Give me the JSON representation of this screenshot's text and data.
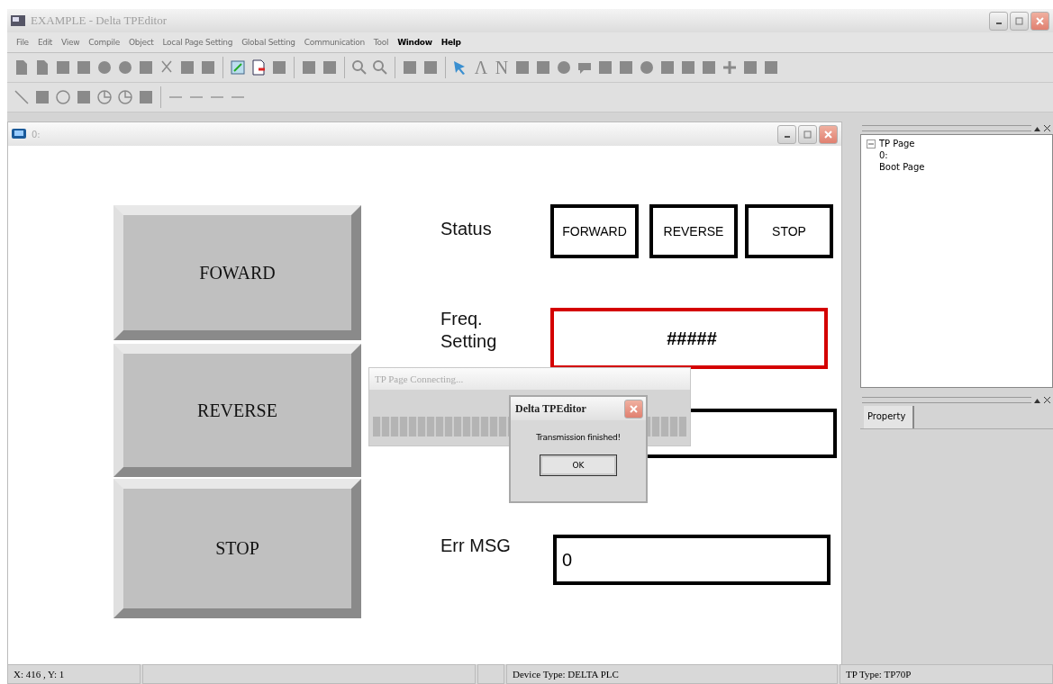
{
  "window": {
    "title": "EXAMPLE - Delta TPEditor"
  },
  "menu": [
    {
      "label": "File",
      "disabled": true
    },
    {
      "label": "Edit",
      "disabled": true
    },
    {
      "label": "View",
      "disabled": true
    },
    {
      "label": "Compile",
      "disabled": true
    },
    {
      "label": "Object",
      "disabled": true
    },
    {
      "label": "Local Page Setting",
      "disabled": true
    },
    {
      "label": "Global Setting",
      "disabled": true
    },
    {
      "label": "Communication",
      "disabled": true
    },
    {
      "label": "Tool",
      "disabled": true
    },
    {
      "label": "Window",
      "disabled": false
    },
    {
      "label": "Help",
      "disabled": false
    }
  ],
  "toolbar_text_tools": [
    "Λ",
    "N"
  ],
  "page_window": {
    "title": "0:"
  },
  "canvas": {
    "buttons": [
      {
        "label": "FOWARD"
      },
      {
        "label": "REVERSE"
      },
      {
        "label": "STOP"
      }
    ],
    "labels": [
      "Status",
      "Freq. Setting",
      "Err MSG"
    ],
    "status_lamps": [
      "FORWARD",
      "REVERSE",
      "STOP"
    ],
    "freq_display": "#####",
    "err_display": "0"
  },
  "connecting_dialog": {
    "title": "TP Page Connecting...",
    "level": 1
  },
  "message_box": {
    "title": "Delta TPEditor",
    "message": "Transmission finished!",
    "button": "OK"
  },
  "project_tree": {
    "items": [
      {
        "label": "TP Page",
        "expanded": true,
        "children": [
          {
            "label": "0:"
          },
          {
            "label": "Boot Page"
          }
        ]
      }
    ]
  },
  "property_panel": {
    "tabs": [
      {
        "label": "Property",
        "selected": true
      }
    ]
  },
  "status_bar": {
    "cursor": "X: 416 , Y: 1",
    "device_type": "Device Type: DELTA PLC",
    "tp_type": "TP Type: TP70P"
  }
}
